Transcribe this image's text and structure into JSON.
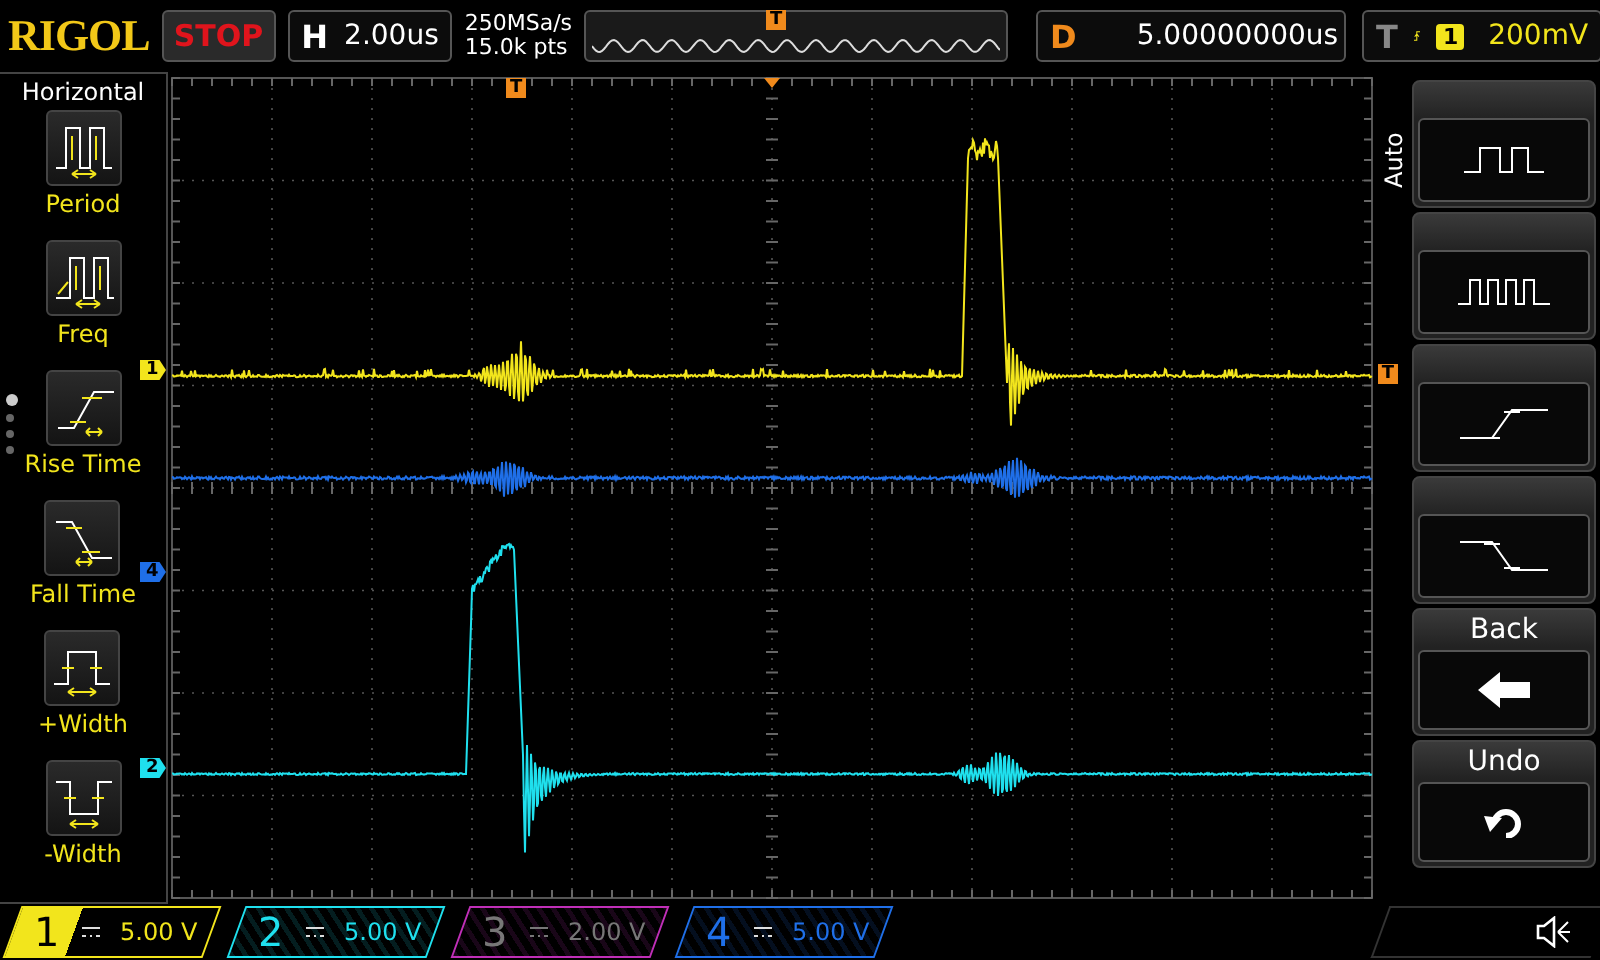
{
  "brand": "RIGOL",
  "run_state": "STOP",
  "horizontal": {
    "label": "H",
    "timebase": "2.00us"
  },
  "acquisition": {
    "sample_rate": "250MSa/s",
    "memory_depth": "15.0k pts"
  },
  "memory_overview": {
    "trigger_marker": "T"
  },
  "delay": {
    "label": "D",
    "value": "5.00000000us"
  },
  "trigger": {
    "label": "T",
    "source": "1",
    "level": "200mV"
  },
  "measure_menu": {
    "title": "Horizontal",
    "page_dots": [
      {
        "selected": true
      },
      {
        "selected": false
      },
      {
        "selected": false
      },
      {
        "selected": false
      }
    ],
    "items": [
      {
        "kind": "period",
        "label": "Period"
      },
      {
        "kind": "frequency",
        "label": "Freq"
      },
      {
        "kind": "rise",
        "label": "Rise Time"
      },
      {
        "kind": "fall",
        "label": "Fall Time"
      },
      {
        "kind": "positive-width",
        "label": "+Width"
      },
      {
        "kind": "negative-width",
        "label": "-Width"
      }
    ]
  },
  "grid_markers": {
    "trigger_position": "T",
    "trigger_level": "T",
    "channel_markers": [
      {
        "label": "1",
        "color": "#f2e51c"
      },
      {
        "label": "4",
        "color": "#1f6fe8"
      },
      {
        "label": "2",
        "color": "#1fe0ee"
      }
    ]
  },
  "softkeys": {
    "side_label": "Auto",
    "keys": [
      {
        "kind": "pulse"
      },
      {
        "kind": "pulse-train"
      },
      {
        "kind": "rising-edge"
      },
      {
        "kind": "falling-edge"
      },
      {
        "kind": "back",
        "label": "Back"
      },
      {
        "kind": "undo",
        "label": "Undo"
      }
    ]
  },
  "channels": [
    {
      "number": "1",
      "scale": "5.00 V",
      "color": "#f2e51c",
      "on": true,
      "selected": true
    },
    {
      "number": "2",
      "scale": "5.00 V",
      "color": "#1fe0ee",
      "on": true,
      "selected": false
    },
    {
      "number": "3",
      "scale": "2.00 V",
      "color": "#c02fb8",
      "on": false,
      "selected": false
    },
    {
      "number": "4",
      "scale": "5.00 V",
      "color": "#1f6fe8",
      "on": true,
      "selected": false
    }
  ]
}
